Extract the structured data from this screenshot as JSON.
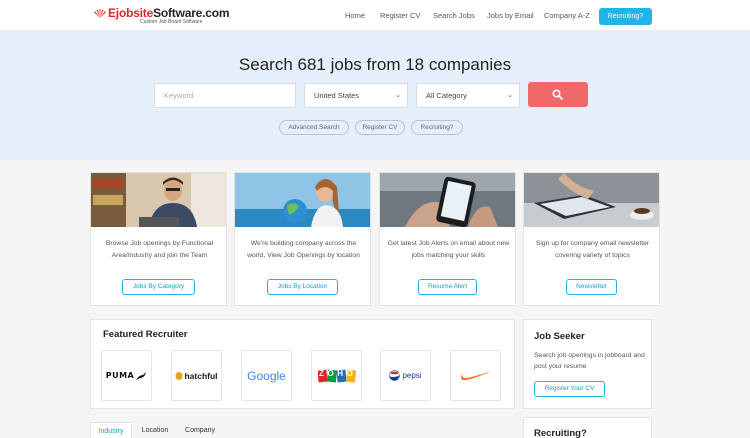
{
  "brand": {
    "name_part1": "Ejobsite",
    "name_part2": "Software.com",
    "tagline": "Custom Job Board Software"
  },
  "nav": {
    "items": [
      "Home",
      "Register CV",
      "Search Jobs",
      "Jobs by Email",
      "Company A-Z"
    ],
    "cta": "Recruiting?"
  },
  "hero": {
    "title": "Search 681 jobs from 18 companies",
    "keyword_placeholder": "Keyword",
    "country_value": "United States",
    "category_value": "All Category",
    "links": [
      "Advanced Search",
      "Register CV",
      "Recruiting?"
    ]
  },
  "cards": [
    {
      "text": "Browse Job openings by Functional Area/Industry and join the Team",
      "button": "Jobs By Category"
    },
    {
      "text": "We're building company across the world, View Job Openings by location",
      "button": "Jobs By Location"
    },
    {
      "text": "Get latest Job Alerts on email about new jobs matching your skills",
      "button": "Resume Alert"
    },
    {
      "text": "Sign up for company email newsletter covering variety of topics",
      "button": "Newsletter"
    }
  ],
  "featured": {
    "title": "Featured Recruiter",
    "recruiters": [
      "puma",
      "hatchful",
      "Google",
      "ZOHO",
      "pepsi",
      "nike"
    ]
  },
  "job_seeker": {
    "title": "Job Seeker",
    "text": "Search job openings in jobboard and post your resume",
    "button": "Register Your CV"
  },
  "tabs": [
    "Industry",
    "Location",
    "Company"
  ],
  "recruiting": {
    "title": "Recruiting?"
  },
  "colors": {
    "accent": "#1fb5e8",
    "search": "#f0686a",
    "hero_bg": "#e4eff9",
    "logo_red": "#e0262b"
  },
  "icons": {
    "search": "search-icon",
    "dropdown": "chevron-down-icon",
    "logo": "sunburst-logo-icon"
  }
}
